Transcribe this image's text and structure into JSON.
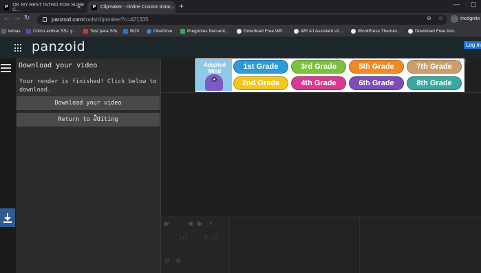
{
  "browser": {
    "tabs": [
      {
        "title": "OK MY BEST INTRO FOR SURE C...",
        "active": false
      },
      {
        "title": "Clipmaker - Online Custom Intro ...",
        "active": true
      }
    ],
    "url_domain": "panzoid.com",
    "url_path": "/tools/clipmaker?c=421335",
    "profile_label": "Incógnito",
    "bookmarks": [
      "temas",
      "Cómo activar SSL y...",
      "Test para SSL",
      "BOX",
      "OneDrive",
      "Preguntas frecuent...",
      "Download Free WP...",
      "WP AJ Assistant v2....",
      "WordPress Themes...",
      "Download Free Astr..."
    ]
  },
  "site": {
    "logo": "panzoid",
    "login_label": "Log in"
  },
  "panel": {
    "title": "Download your video",
    "message": "Your render is finished! Click below to download.",
    "download_button": "Download your video",
    "return_button": "Return to editing"
  },
  "ad": {
    "brand": "Adapted Mind",
    "grades": [
      {
        "label": "1st Grade",
        "color": "#2f9ad8"
      },
      {
        "label": "3rd Grade",
        "color": "#7cc142"
      },
      {
        "label": "5th Grade",
        "color": "#f08a24"
      },
      {
        "label": "7th Grade",
        "color": "#c9a06b"
      },
      {
        "label": "2nd Grade",
        "color": "#f2c81d"
      },
      {
        "label": "4th Grade",
        "color": "#d63b8f"
      },
      {
        "label": "6th Grade",
        "color": "#7b4fb6"
      },
      {
        "label": "8th Grade",
        "color": "#3aa9a0"
      }
    ]
  },
  "timeline": {
    "current": "1+1",
    "duration": "0:12"
  }
}
